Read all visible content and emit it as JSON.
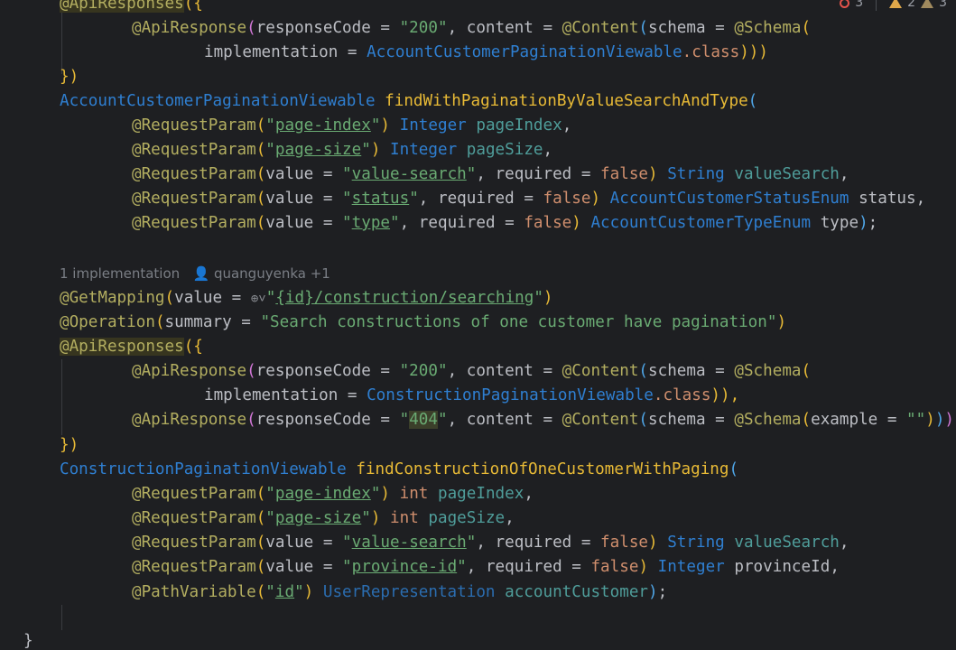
{
  "inspection": {
    "errors": "3",
    "warnings": "2",
    "weak_warnings": "3"
  },
  "code": {
    "l1": "@ApiResponses",
    "l1b": "({",
    "l2_anno": "@ApiResponse",
    "l2_a": "responseCode = ",
    "l2_s": "\"200\"",
    "l2_b": ", content = ",
    "l2_c": "@Content",
    "l2_d": "schema = ",
    "l2_e": "@Schema",
    "l3_a": "implementation = ",
    "l3_t": "AccountCustomerPaginationViewable",
    "l3_k": ".class",
    "l3_end": ")))",
    "l4": "})",
    "l5_type": "AccountCustomerPaginationViewable",
    "l5_method": "findWithPaginationByValueSearchAndType",
    "rp": "@RequestParam",
    "pv": "@PathVariable",
    "s_page_index": "page-index",
    "s_page_size": "page-size",
    "s_value_search": "value-search",
    "s_status": "status",
    "s_type": "type",
    "s_province_id": "province-id",
    "s_id": "id",
    "value_eq": "value = ",
    "required_eq": ", required = ",
    "false": "false",
    "t_integer": "Integer",
    "t_int": "int",
    "t_string": "String",
    "t_status_enum": "AccountCustomerStatusEnum",
    "t_type_enum": "AccountCustomerTypeEnum",
    "t_user_rep": "UserRepresentation",
    "p_page_index": "pageIndex",
    "p_page_size": "pageSize",
    "p_value_search": "valueSearch",
    "p_status": "status",
    "p_type": "type",
    "p_province_id": "provinceId",
    "p_account_customer": "accountCustomer",
    "hint_impl": "1 implementation",
    "hint_author": "quanguyenka +1",
    "get_mapping": "@GetMapping",
    "gm_url": "{id}/construction/searching",
    "operation": "@Operation",
    "op_summary_eq": "summary = ",
    "op_summary": "\"Search constructions of one customer have pagination\"",
    "l13_t": "ConstructionPaginationViewable",
    "l13_end": ")),",
    "s_404_num": "404",
    "example_eq": "example = ",
    "empty_str": "\"\"",
    "l16_type": "ConstructionPaginationViewable",
    "l16_method": "findConstructionOfOneCustomerWithPaging",
    "close_brace": "}"
  }
}
